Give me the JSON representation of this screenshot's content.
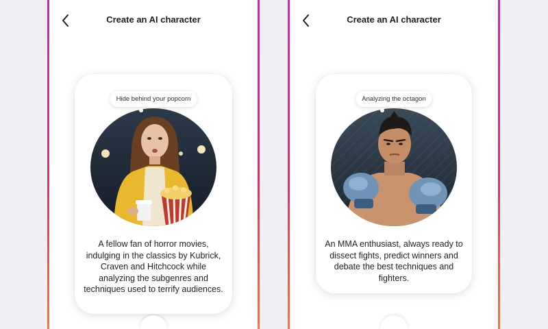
{
  "screens": [
    {
      "header": {
        "title": "Create an AI character",
        "back_icon": "chevron-left-icon"
      },
      "card": {
        "bubble_text": "Hide behind your popcorn",
        "portrait": "horror-fan-portrait",
        "description": "A fellow fan of horror movies, indulging in the classics by Kubrick, Craven and Hitchcock while analyzing the subgenres and techniques used to terrify audiences."
      }
    },
    {
      "header": {
        "title": "Create an AI character",
        "back_icon": "chevron-left-icon"
      },
      "card": {
        "bubble_text": "Analyzing the octagon",
        "portrait": "mma-fan-portrait",
        "description": "An MMA enthusiast, always ready to dissect fights, predict winners and debate the best techniques and fighters."
      }
    }
  ],
  "colors": {
    "edge_top": "#c42bb0",
    "edge_mid": "#d6336c",
    "edge_bottom": "#f07a3a",
    "background": "#eef0f4",
    "text": "#1c1e21"
  }
}
